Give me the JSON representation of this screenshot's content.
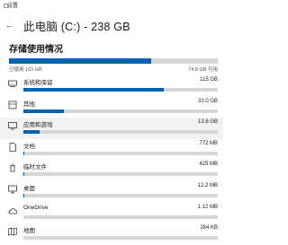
{
  "window": {
    "title": "设置"
  },
  "header": {
    "title": "此电脑 (C:) - 238 GB"
  },
  "section": {
    "title": "存储使用情况"
  },
  "overall": {
    "used_label": "已使用 163 GB",
    "free_label": "74.8 GB 可用",
    "used_fraction": 0.68
  },
  "categories": [
    {
      "name": "系统和保留",
      "size": "115 GB",
      "fraction": 0.72,
      "icon": "system-icon",
      "key": "system"
    },
    {
      "name": "其他",
      "size": "33.0 GB",
      "fraction": 0.21,
      "icon": "other-icon",
      "key": "other"
    },
    {
      "name": "应用和游戏",
      "size": "13.6 GB",
      "fraction": 0.085,
      "icon": "apps-icon",
      "key": "apps",
      "hover": true
    },
    {
      "name": "文档",
      "size": "772 MB",
      "fraction": 0.005,
      "icon": "document-icon",
      "key": "documents"
    },
    {
      "name": "临时文件",
      "size": "425 MB",
      "fraction": 0.003,
      "icon": "trash-icon",
      "key": "temp"
    },
    {
      "name": "桌面",
      "size": "12.2 MB",
      "fraction": 0.001,
      "icon": "desktop-icon",
      "key": "desktop"
    },
    {
      "name": "OneDrive",
      "size": "1.12 MB",
      "fraction": 0.0,
      "icon": "cloud-icon",
      "key": "onedrive"
    },
    {
      "name": "地图",
      "size": "264 KB",
      "fraction": 0.0,
      "icon": "map-icon",
      "key": "maps"
    }
  ],
  "colors": {
    "accent": "#0063b1",
    "track": "#d6d6d6"
  }
}
